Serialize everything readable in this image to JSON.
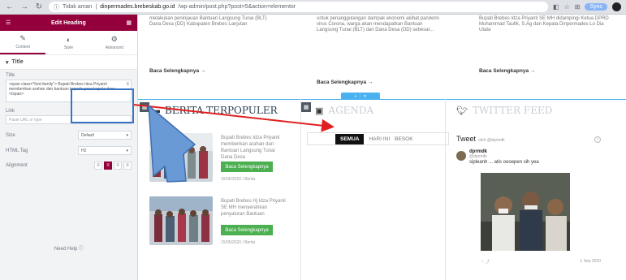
{
  "browser": {
    "url_prefix": "Tidak aman",
    "url_host": "dinpermades.brebeskab.go.id",
    "url_path": "/wp-admin/post.php?post=5&action=elementor",
    "sync_label": "Sync",
    "colors": {
      "chrome": "#dee1e6",
      "sync": "#8ab4f8"
    }
  },
  "panel": {
    "title": "Edit Heading",
    "tabs": [
      {
        "label": "Content",
        "icon": "pencil-icon"
      },
      {
        "label": "Style",
        "icon": "half-circle-icon"
      },
      {
        "label": "Advanced",
        "icon": "gear-icon"
      }
    ],
    "section_title": "Title",
    "title_label": "Title",
    "title_value": "<span class=\"font-family\"> Bupati Brebes Idza Priyanti memberikan arahan dan bantuan kepada para kepala desa...</span>",
    "link_label": "Link",
    "link_placeholder": "Paste URL or type",
    "size_label": "Size",
    "size_value": "Default",
    "html_tag_label": "HTML Tag",
    "html_tag_value": "H2",
    "alignment_label": "Alignment",
    "need_help": "Need Help",
    "accent": "#93003c"
  },
  "page": {
    "top_cards": [
      {
        "text": "melakukan peninjauan Bantuan Langsung Tunai (BLT) Dana Desa (DD) Kabupaten Brebes Lanjutan",
        "link": "Baca Selengkapnya →"
      },
      {
        "text": "untuk penanggulangan dampak ekonomi akibat pandemi virus Corona, warga akan mendapatkan Bantuan Langsung Tunai (BLT) dari Dana Desa (DD) sebesar...",
        "link": "Baca Selengkapnya →"
      },
      {
        "text": "Bupati Brebes Idza Priyanti SE MH didampingi Ketua DPRD Muhammad Taufik, S.Ag dan Kepala Dinpermades Lo Dia Utata",
        "link": "Baca Selengkapnya →"
      }
    ],
    "add_section_label": "+ ⋮ ✕",
    "popular": {
      "title": "BERITA TERPOPULER",
      "posts": [
        {
          "title": "Bupati Brebes Idza Priyanti memberikan arahan dan Bantuan Langsung Tunai Dana Desa",
          "button": "Baca Selengkapnya",
          "date": "15/05/2020 / Berita"
        },
        {
          "title": "Bupati Brebes Hj Idza Priyanti SE MH menyerahkan penyaluran Bantuan",
          "button": "Baca Selengkapnya",
          "date": "15/05/2020 / Berita"
        }
      ]
    },
    "agenda": {
      "title": "AGENDA",
      "tabs": [
        "SEMUA",
        "HARI INI",
        "BESOK"
      ]
    },
    "twitter": {
      "title": "TWITTER FEED",
      "header": "Tweet",
      "by": "oleh @dprmdk",
      "name": "dprmdk",
      "handle": "@dprmdk",
      "text": "sipleanh ... atis oooepen sih yea",
      "date": "1 Sep 2020"
    },
    "colors": {
      "section_line": "#4ab1f1",
      "button": "#4caf50",
      "title": "#2c3e50"
    }
  },
  "annotations": {
    "box_color": "#3b73c4",
    "arrow_color": "#e02020",
    "big_arrow_color": "#6a9ad6"
  }
}
